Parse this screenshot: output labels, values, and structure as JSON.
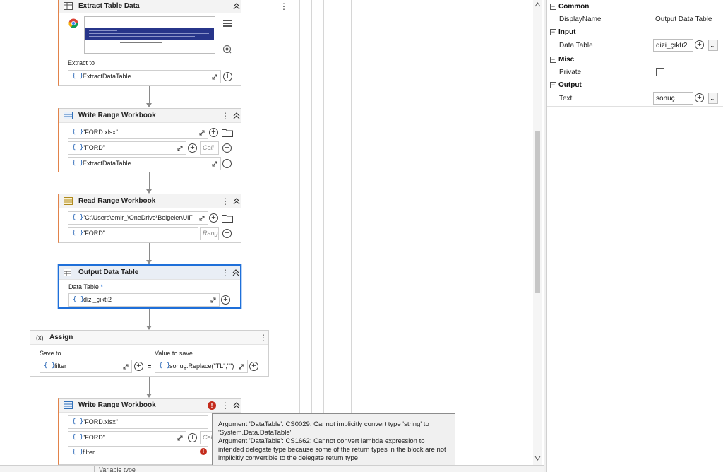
{
  "activities": {
    "extract": {
      "title": "Extract Table Data",
      "extract_to_label": "Extract to",
      "extract_to_value": "ExtractDataTable"
    },
    "write1": {
      "title": "Write Range Workbook",
      "path": "\"FORD.xlsx\"",
      "sheet": "\"FORD\"",
      "cell_placeholder": "Cell",
      "data": "ExtractDataTable"
    },
    "read": {
      "title": "Read Range Workbook",
      "path": "\"C:\\Users\\emir_\\OneDrive\\Belgeler\\UiF",
      "sheet": "\"FORD\"",
      "range_placeholder": "Range"
    },
    "output": {
      "title": "Output Data Table",
      "datatable_label": "Data Table",
      "required_mark": "*",
      "datatable_value": "dizi_çıktı2"
    },
    "assign": {
      "title": "Assign",
      "icon_text": "(x)",
      "save_to_label": "Save to",
      "save_to_value": "filter",
      "equals": "=",
      "value_label": "Value to save",
      "value_value": "sonuç.Replace(\"TL\",\"\")"
    },
    "write2": {
      "title": "Write Range Workbook",
      "path": "\"FORD.xlsx\"",
      "sheet": "\"FORD\"",
      "cell_placeholder": "Cell",
      "data": "filter"
    }
  },
  "tooltip": {
    "line1": "Argument 'DataTable': CS0029: Cannot implicitly convert type 'string' to 'System.Data.DataTable'",
    "line2": "Argument 'DataTable': CS1662: Cannot convert lambda expression to intended delegate type because some of the return types in the block are not implicitly convertible to the delegate return type"
  },
  "bottom": {
    "variable_type_label": "Variable type"
  },
  "properties": {
    "common": {
      "title": "Common",
      "display_name_label": "DisplayName",
      "display_name_value": "Output Data Table"
    },
    "input": {
      "title": "Input",
      "data_table_label": "Data Table",
      "data_table_value": "dizi_çıktı2"
    },
    "misc": {
      "title": "Misc",
      "private_label": "Private",
      "private_checked": false
    },
    "output": {
      "title": "Output",
      "text_label": "Text",
      "text_value": "sonuç"
    },
    "toggle_glyph": "−",
    "dots": "..."
  },
  "glyphs": {
    "braces": "{ }",
    "plus": "+",
    "kebab": "⋮",
    "error": "!"
  },
  "colors": {
    "selection": "#1e6fd9",
    "error": "#c42b1c",
    "expression": "#1e5fb3"
  }
}
